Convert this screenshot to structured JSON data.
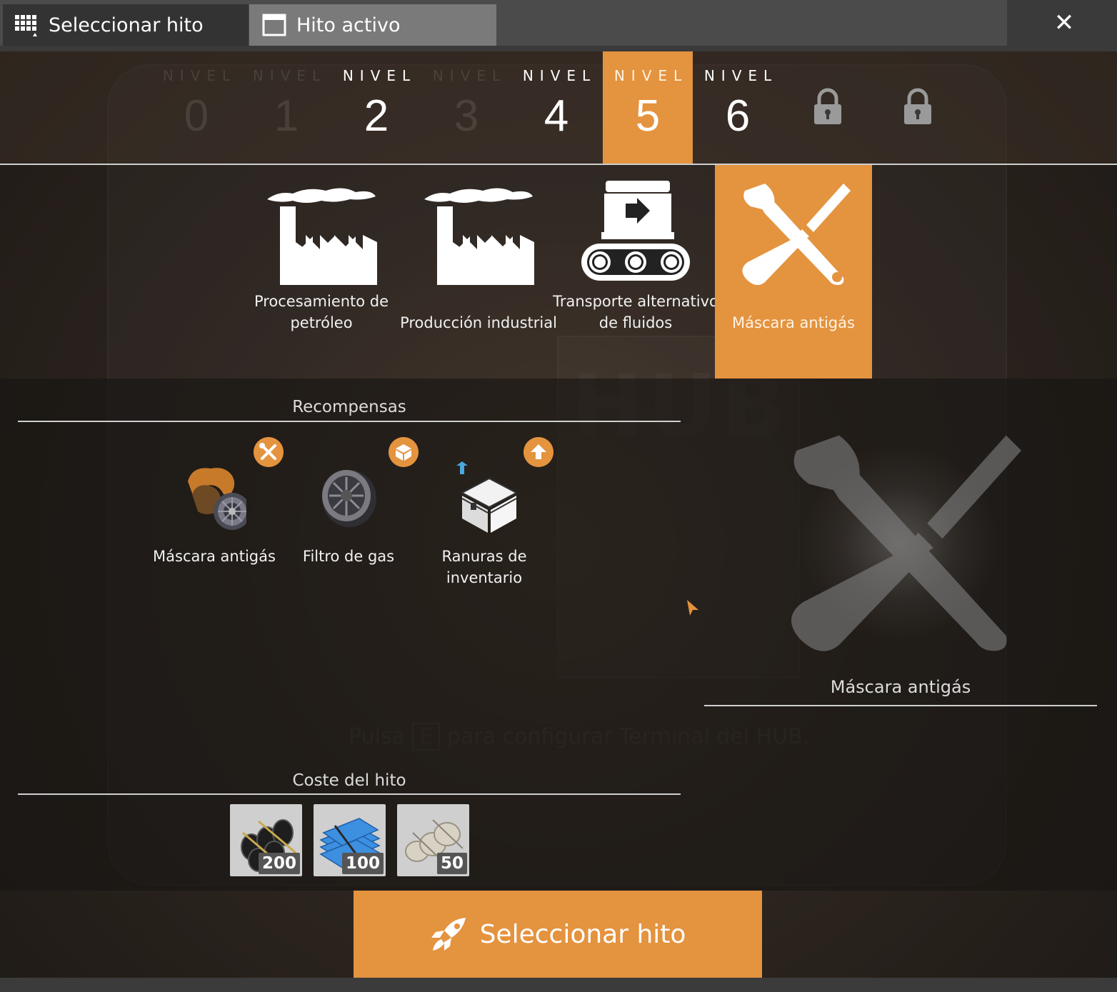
{
  "tabs": {
    "select_label": "Seleccionar hito",
    "active_label": "Hito activo",
    "close_icon": "close-icon"
  },
  "tiers": [
    {
      "label": "NIVEL",
      "number": "0",
      "state": "dim"
    },
    {
      "label": "NIVEL",
      "number": "1",
      "state": "dim"
    },
    {
      "label": "NIVEL",
      "number": "2",
      "state": "available"
    },
    {
      "label": "NIVEL",
      "number": "3",
      "state": "dim"
    },
    {
      "label": "NIVEL",
      "number": "4",
      "state": "available"
    },
    {
      "label": "NIVEL",
      "number": "5",
      "state": "selected"
    },
    {
      "label": "NIVEL",
      "number": "6",
      "state": "available"
    },
    {
      "label": "",
      "number": "",
      "state": "locked",
      "icon": "padlock-icon"
    },
    {
      "label": "",
      "number": "",
      "state": "locked",
      "icon": "padlock-icon"
    }
  ],
  "milestones": [
    {
      "name": "Procesamiento de petróleo",
      "icon": "factory-icon",
      "selected": false
    },
    {
      "name": "Producción industrial",
      "icon": "factory-icon",
      "selected": false
    },
    {
      "name": "Transporte alternativo de fluidos",
      "icon": "conveyor-icon",
      "selected": false
    },
    {
      "name": "Máscara antigás",
      "icon": "wrench-screwdriver-icon",
      "selected": true
    }
  ],
  "rewards_title": "Recompensas",
  "rewards": [
    {
      "name": "Máscara antigás",
      "icon": "gas-mask-icon",
      "badge_icon": "wrench-screwdriver-icon"
    },
    {
      "name": "Filtro de gas",
      "icon": "gas-filter-icon",
      "badge_icon": "box-icon"
    },
    {
      "name": "Ranuras de inventario",
      "icon": "inventory-box-icon",
      "badge_icon": "arrow-up-icon"
    }
  ],
  "preview": {
    "name": "Máscara antigás",
    "icon": "wrench-screwdriver-icon"
  },
  "cost_title": "Coste del hito",
  "costs": [
    {
      "item_icon": "rubber-icon",
      "quantity": "200"
    },
    {
      "item_icon": "plastic-icon",
      "quantity": "100"
    },
    {
      "item_icon": "fabric-icon",
      "quantity": "50"
    }
  ],
  "background_hint": {
    "prefix": "Pulsa",
    "key": "E",
    "suffix": "para configurar Terminal del HUB."
  },
  "select_button": {
    "label": "Seleccionar hito",
    "icon": "rocket-icon"
  },
  "colors": {
    "accent": "#e4933f",
    "tab_active": "#7a7a7a",
    "tab_inactive": "#333333"
  }
}
